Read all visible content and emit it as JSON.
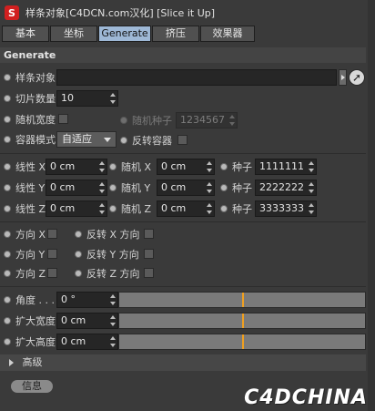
{
  "window": {
    "title": "样条对象[C4DCN.com汉化] [Slice it Up]",
    "icon_letter": "S"
  },
  "tabs": [
    {
      "label": "基本"
    },
    {
      "label": "坐标"
    },
    {
      "label": "Generate"
    },
    {
      "label": "挤压"
    },
    {
      "label": "效果器"
    }
  ],
  "section": {
    "title": "Generate"
  },
  "spline": {
    "label": "样条对象",
    "value": ""
  },
  "slices": {
    "label": "切片数量",
    "value": "10"
  },
  "random_width": {
    "label": "随机宽度",
    "checked": false
  },
  "random_seed": {
    "label": "随机种子",
    "value": "1234567"
  },
  "container_mode": {
    "label": "容器模式",
    "value": "自适应"
  },
  "reverse_container": {
    "label": "反转容器",
    "checked": false
  },
  "linear": [
    {
      "axis": "线性 X",
      "value": "0 cm",
      "rand_label": "随机 X",
      "rand_value": "0 cm",
      "seed_label": "种子",
      "seed_value": "1111111"
    },
    {
      "axis": "线性 Y",
      "value": "0 cm",
      "rand_label": "随机 Y",
      "rand_value": "0 cm",
      "seed_label": "种子",
      "seed_value": "2222222"
    },
    {
      "axis": "线性 Z",
      "value": "0 cm",
      "rand_label": "随机 Z",
      "rand_value": "0 cm",
      "seed_label": "种子",
      "seed_value": "3333333"
    }
  ],
  "directions": [
    {
      "label": "方向 X",
      "rev_label": "反转 X 方向"
    },
    {
      "label": "方向 Y",
      "rev_label": "反转 Y 方向"
    },
    {
      "label": "方向 Z",
      "rev_label": "反转 Z 方向"
    }
  ],
  "angle": {
    "label": "角度 . . .",
    "value": "0 °",
    "slider_fraction": 0.5
  },
  "expand_width": {
    "label": "扩大宽度",
    "value": "0 cm",
    "slider_fraction": 0.5
  },
  "expand_height": {
    "label": "扩大高度",
    "value": "0 cm",
    "slider_fraction": 0.5
  },
  "advanced": {
    "label": "高级"
  },
  "info_button": {
    "label": "信息"
  },
  "watermark": {
    "text": "C4DCHINA"
  },
  "colors": {
    "active_tab": "#9eb8d6",
    "slider_marker": "#f0a020",
    "logo_red": "#d02020"
  }
}
